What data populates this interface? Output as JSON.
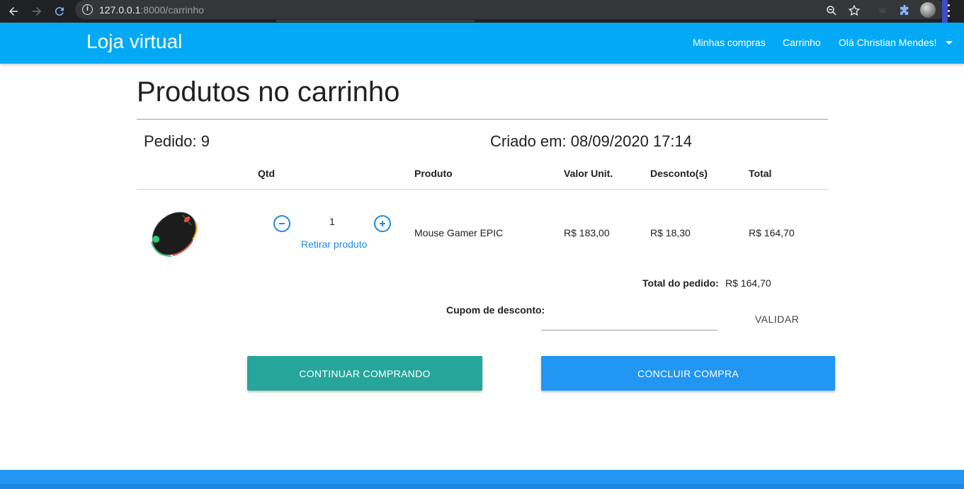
{
  "browser": {
    "url_host": "127.0.0.1",
    "url_rest": ":8000/carrinho"
  },
  "nav": {
    "brand": "Loja virtual",
    "links": [
      "Minhas compras",
      "Carrinho",
      "Olá Christian Mendes!"
    ]
  },
  "page": {
    "title": "Produtos no carrinho",
    "order": "Pedido: 9",
    "created": "Criado em: 08/09/2020 17:14"
  },
  "table": {
    "headers": [
      "Qtd",
      "Produto",
      "Valor Unit.",
      "Desconto(s)",
      "Total"
    ],
    "rows": [
      {
        "qty": "1",
        "remove": "Retirar produto",
        "product": "Mouse Gamer EPIC",
        "unit_price": "R$ 183,00",
        "discount": "R$ 18,30",
        "total": "R$ 164,70"
      }
    ]
  },
  "summary": {
    "total_label": "Total do pedido:",
    "total_value": "R$ 164,70"
  },
  "coupon": {
    "label": "Cupom de desconto:",
    "value": "",
    "validate": "VALIDAR"
  },
  "actions": {
    "continue": "CONTINUAR COMPRANDO",
    "finish": "CONCLUIR COMPRA"
  },
  "colors": {
    "nav": "#03a9f4",
    "continue": "#26a69a",
    "finish": "#2196f3",
    "link": "#1e88e5"
  }
}
